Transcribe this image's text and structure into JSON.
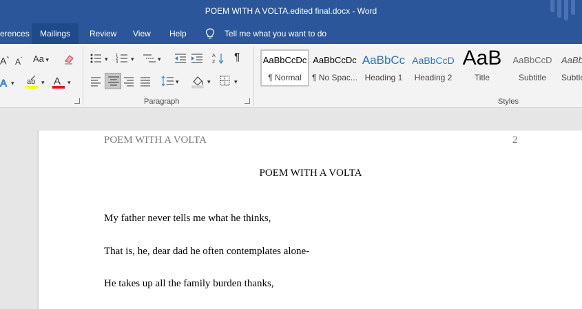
{
  "window": {
    "title": "POEM WITH A VOLTA.edited final.docx  -  Word"
  },
  "tabs": [
    {
      "label": "erences"
    },
    {
      "label": "Mailings"
    },
    {
      "label": "Review"
    },
    {
      "label": "View"
    },
    {
      "label": "Help"
    }
  ],
  "tell_me": {
    "label": "Tell me what you want to do"
  },
  "ribbon": {
    "paragraph_label": "Paragraph",
    "styles_label": "Styles",
    "font_small_a": "A",
    "font_big_a": "A",
    "font_aa": "Aa",
    "pilcrow": "¶",
    "styles": [
      {
        "sample": "AaBbCcDc",
        "name": "¶ Normal"
      },
      {
        "sample": "AaBbCcDc",
        "name": "¶ No Spac..."
      },
      {
        "sample": "AaBbCc",
        "name": "Heading 1"
      },
      {
        "sample": "AaBbCcD",
        "name": "Heading 2"
      },
      {
        "sample": "AaB",
        "name": "Title"
      },
      {
        "sample": "AaBbCcD",
        "name": "Subtitle"
      },
      {
        "sample": "AaBbC",
        "name": "Subtle"
      }
    ]
  },
  "colors": {
    "brand": "#2b579a",
    "highlight": "#ffff00",
    "font_color": "#e81123"
  },
  "document": {
    "header_left": "POEM WITH A VOLTA",
    "page_number": "2",
    "title": "POEM WITH A VOLTA",
    "lines": [
      "My father never tells me what he thinks,",
      "That is, he, dear dad he often contemplates alone-",
      "He takes up all the family burden thanks,"
    ]
  }
}
